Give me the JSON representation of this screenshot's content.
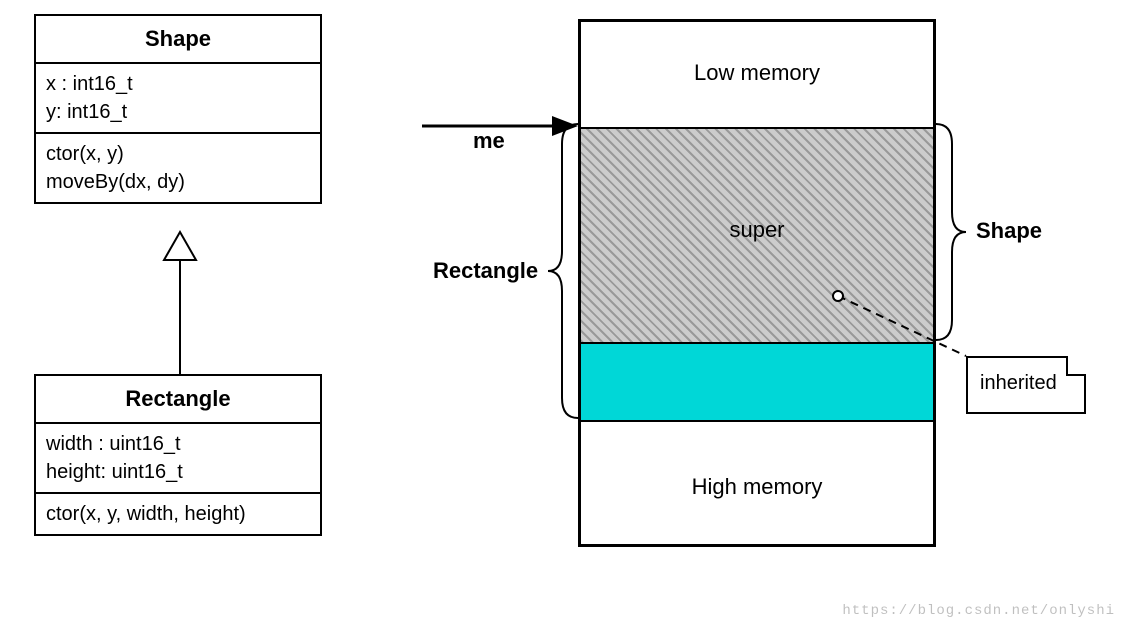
{
  "uml": {
    "shape": {
      "name": "Shape",
      "attributes": [
        "x : int16_t",
        "y: int16_t"
      ],
      "methods": [
        "ctor(x, y)",
        "moveBy(dx, dy)"
      ]
    },
    "rectangle": {
      "name": "Rectangle",
      "attributes": [
        "width : uint16_t",
        "height: uint16_t"
      ],
      "methods": [
        "ctor(x, y, width, height)"
      ]
    }
  },
  "memory": {
    "top_label": "Low memory",
    "bottom_label": "High memory",
    "super_label": "super",
    "left_brace_label": "Rectangle",
    "right_brace_label": "Shape",
    "pointer_label": "me",
    "note": "inherited"
  },
  "watermark": "https://blog.csdn.net/onlyshi"
}
